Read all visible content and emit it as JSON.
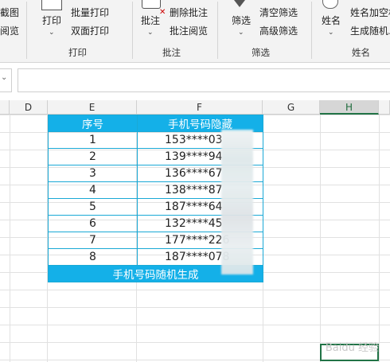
{
  "ribbon": {
    "col0": {
      "item1": "截图",
      "item2": "阅览"
    },
    "print_group": {
      "print": "打印",
      "batch_print": "批量打印",
      "duplex_print": "双面打印",
      "label": "打印"
    },
    "comment_group": {
      "comment": "批注",
      "delete_comment": "删除批注",
      "comment_browse": "批注阅览",
      "label": "批注"
    },
    "filter_group": {
      "filter": "筛选",
      "clear_filter": "清空筛选",
      "advanced_filter": "高级筛选",
      "label": "筛选"
    },
    "name_group": {
      "name": "姓名",
      "name_add_space": "姓名加空格",
      "random_generate": "生成随机…",
      "label": "姓名"
    }
  },
  "columns": [
    "D",
    "E",
    "F",
    "G",
    "H"
  ],
  "table": {
    "headers": [
      "序号",
      "手机号码隐藏"
    ],
    "rows": [
      {
        "n": "1",
        "phone": "153****03"
      },
      {
        "n": "2",
        "phone": "139****94"
      },
      {
        "n": "3",
        "phone": "136****67"
      },
      {
        "n": "4",
        "phone": "138****87"
      },
      {
        "n": "5",
        "phone": "187****64"
      },
      {
        "n": "6",
        "phone": "132****45"
      },
      {
        "n": "7",
        "phone": "177****226"
      },
      {
        "n": "8",
        "phone": "187****078"
      }
    ],
    "footer": "手机号码随机生成"
  },
  "watermark": "Baidu 经验",
  "colors": {
    "header_blue": "#14b0e8",
    "border_blue": "#1aa9d6",
    "excel_green": "#217346"
  }
}
